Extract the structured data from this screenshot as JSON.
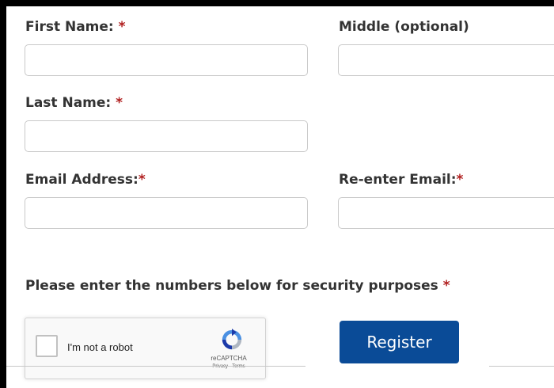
{
  "form": {
    "first_name": {
      "label": "First Name:",
      "required": "*",
      "value": ""
    },
    "middle_name": {
      "label": "Middle (optional)",
      "value": ""
    },
    "last_name": {
      "label": "Last Name:",
      "required": "*",
      "value": ""
    },
    "email": {
      "label": "Email Address:",
      "required": "*",
      "value": ""
    },
    "reenter_email": {
      "label": "Re-enter Email:",
      "required": "*",
      "value": ""
    }
  },
  "security": {
    "prompt": "Please enter the numbers below for security purposes",
    "required": "*"
  },
  "recaptcha": {
    "checkbox_label": "I'm not a robot",
    "brand": "reCAPTCHA",
    "links": "Privacy - Terms",
    "icon": "recaptcha-logo-icon"
  },
  "actions": {
    "register_label": "Register"
  },
  "colors": {
    "required_marker": "#b01e1e",
    "button_bg": "#0a4b97",
    "button_text": "#ffffff",
    "label_text": "#333333"
  }
}
